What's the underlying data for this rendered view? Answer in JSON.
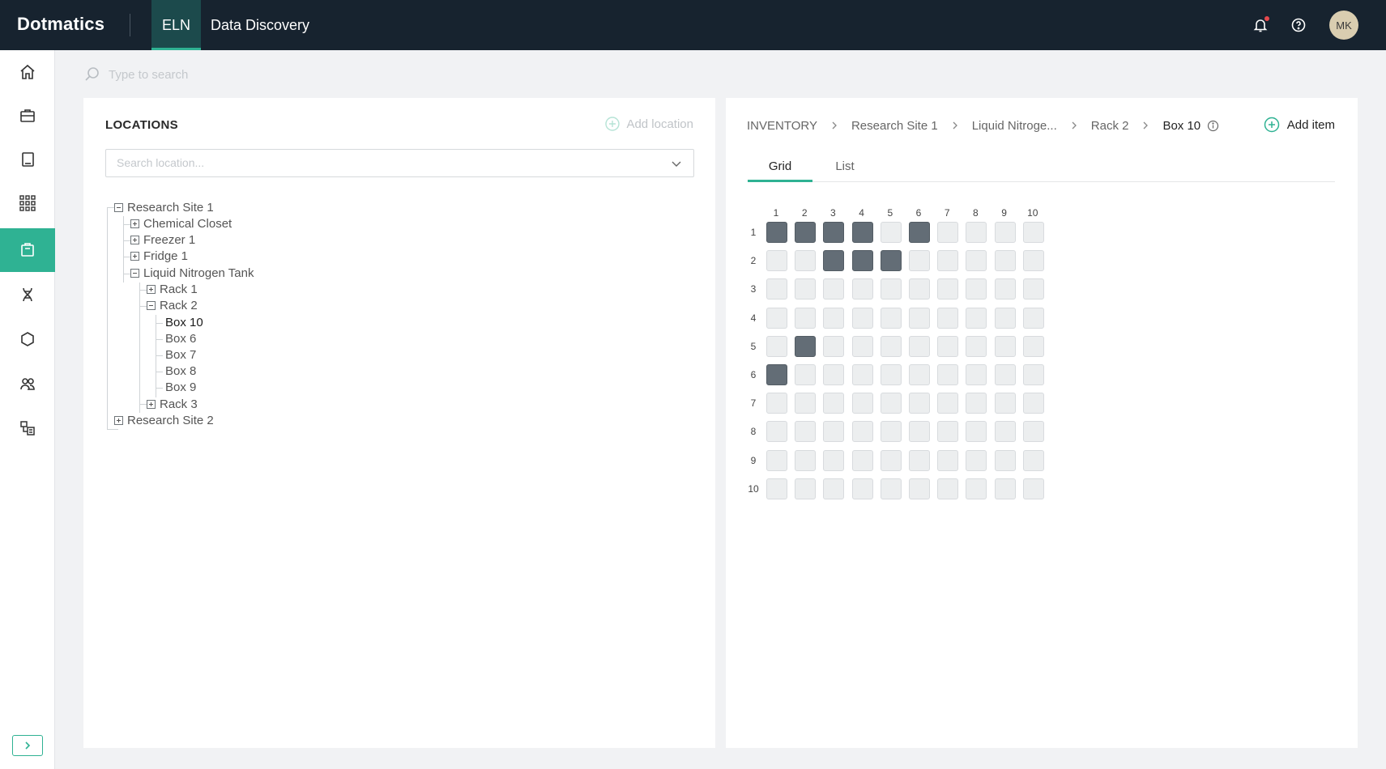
{
  "brand": {
    "name": "Dotmatics"
  },
  "nav": {
    "tabs": [
      {
        "label": "ELN",
        "active": true
      },
      {
        "label": "Data Discovery",
        "active": false
      }
    ]
  },
  "user": {
    "initials": "MK"
  },
  "sidebar": {
    "items": [
      {
        "icon": "home-icon"
      },
      {
        "icon": "briefcase-icon"
      },
      {
        "icon": "notebook-icon"
      },
      {
        "icon": "apps-grid-icon"
      },
      {
        "icon": "inventory-box-icon",
        "active": true
      },
      {
        "icon": "dna-icon"
      },
      {
        "icon": "molecule-icon"
      },
      {
        "icon": "users-icon"
      },
      {
        "icon": "workflow-icon"
      }
    ]
  },
  "search": {
    "placeholder": "Type to search"
  },
  "locations": {
    "title": "LOCATIONS",
    "add_label": "Add location",
    "search_placeholder": "Search location...",
    "tree": [
      {
        "label": "Research Site 1",
        "toggle": "minus"
      },
      {
        "label": "Chemical Closet",
        "toggle": "plus"
      },
      {
        "label": "Freezer 1",
        "toggle": "plus"
      },
      {
        "label": "Fridge 1",
        "toggle": "plus"
      },
      {
        "label": "Liquid Nitrogen Tank",
        "toggle": "minus"
      },
      {
        "label": "Rack 1",
        "toggle": "plus"
      },
      {
        "label": "Rack 2",
        "toggle": "minus"
      },
      {
        "label": "Box 10",
        "toggle": "none",
        "selected": true
      },
      {
        "label": "Box 6",
        "toggle": "none"
      },
      {
        "label": "Box 7",
        "toggle": "none"
      },
      {
        "label": "Box 8",
        "toggle": "none"
      },
      {
        "label": "Box 9",
        "toggle": "none"
      },
      {
        "label": "Rack 3",
        "toggle": "plus"
      },
      {
        "label": "Research Site 2",
        "toggle": "plus"
      }
    ]
  },
  "inventory": {
    "breadcrumb": [
      "INVENTORY",
      "Research Site 1",
      "Liquid Nitroge...",
      "Rack 2",
      "Box 10"
    ],
    "add_item_label": "Add item",
    "tabs": [
      {
        "label": "Grid",
        "active": true
      },
      {
        "label": "List",
        "active": false
      }
    ],
    "grid": {
      "columns": [
        "1",
        "2",
        "3",
        "4",
        "5",
        "6",
        "7",
        "8",
        "9",
        "10"
      ],
      "rows": [
        "1",
        "2",
        "3",
        "4",
        "5",
        "6",
        "7",
        "8",
        "9",
        "10"
      ],
      "occupied": [
        [
          1,
          1,
          1,
          1,
          0,
          1,
          0,
          0,
          0,
          0
        ],
        [
          0,
          0,
          1,
          1,
          1,
          0,
          0,
          0,
          0,
          0
        ],
        [
          0,
          0,
          0,
          0,
          0,
          0,
          0,
          0,
          0,
          0
        ],
        [
          0,
          0,
          0,
          0,
          0,
          0,
          0,
          0,
          0,
          0
        ],
        [
          0,
          1,
          0,
          0,
          0,
          0,
          0,
          0,
          0,
          0
        ],
        [
          1,
          0,
          0,
          0,
          0,
          0,
          0,
          0,
          0,
          0
        ],
        [
          0,
          0,
          0,
          0,
          0,
          0,
          0,
          0,
          0,
          0
        ],
        [
          0,
          0,
          0,
          0,
          0,
          0,
          0,
          0,
          0,
          0
        ],
        [
          0,
          0,
          0,
          0,
          0,
          0,
          0,
          0,
          0,
          0
        ],
        [
          0,
          0,
          0,
          0,
          0,
          0,
          0,
          0,
          0,
          0
        ]
      ]
    }
  },
  "colors": {
    "accent": "#2fb293",
    "topbar": "#17232f",
    "occupied": "#636d76",
    "empty": "#eceeef"
  }
}
